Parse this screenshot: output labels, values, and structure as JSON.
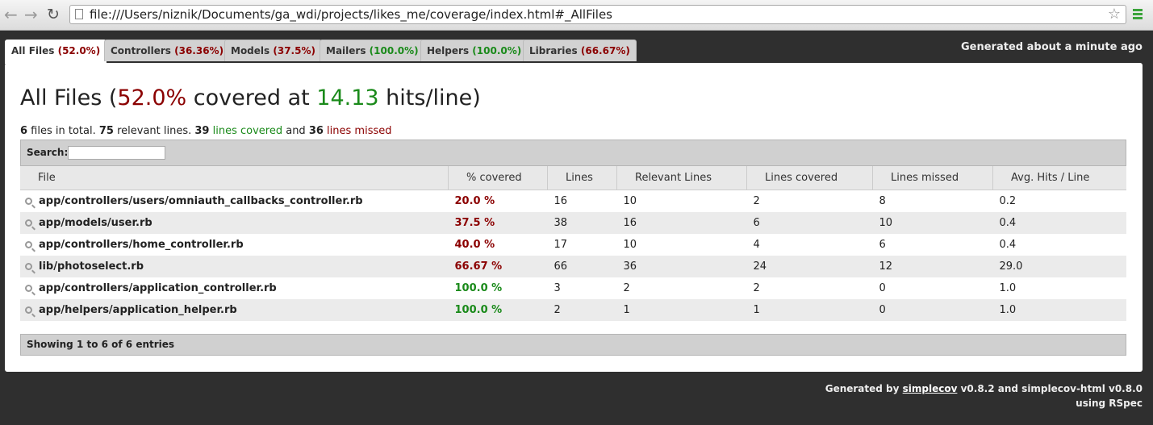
{
  "browser": {
    "url": "file:///Users/niznik/Documents/ga_wdi/projects/likes_me/coverage/index.html#_AllFiles",
    "back": "←",
    "forward": "→",
    "reload": "↻",
    "star": "☆"
  },
  "tabs": [
    {
      "label": "All Files",
      "pct": "(52.0%)",
      "status": "red"
    },
    {
      "label": "Controllers",
      "pct": "(36.36%)",
      "status": "red"
    },
    {
      "label": "Models",
      "pct": "(37.5%)",
      "status": "red"
    },
    {
      "label": "Mailers",
      "pct": "(100.0%)",
      "status": "green"
    },
    {
      "label": "Helpers",
      "pct": "(100.0%)",
      "status": "green"
    },
    {
      "label": "Libraries",
      "pct": "(66.67%)",
      "status": "red"
    }
  ],
  "generated": {
    "label": "Generated",
    "when": "about a minute ago"
  },
  "main": {
    "title_prefix": "All Files (",
    "title_pct": "52.0%",
    "title_mid": " covered at ",
    "title_hits": "14.13",
    "title_suffix": " hits/line)",
    "files_count": "6",
    "files_text": " files in total. ",
    "relevant_count": "75",
    "relevant_text": " relevant lines. ",
    "covered_count": "39",
    "covered_text": " lines covered",
    "and_text": " and ",
    "missed_count": "36",
    "missed_text": " lines missed",
    "search_label": "Search:",
    "showing": "Showing 1 to 6 of 6 entries"
  },
  "table": {
    "headers": [
      "File",
      "% covered",
      "Lines",
      "Relevant Lines",
      "Lines covered",
      "Lines missed",
      "Avg. Hits / Line"
    ],
    "rows": [
      {
        "file": "app/controllers/users/omniauth_callbacks_controller.rb",
        "covered": "20.0 %",
        "status": "red",
        "lines": "16",
        "relevant": "10",
        "lines_covered": "2",
        "missed": "8",
        "avg": "0.2"
      },
      {
        "file": "app/models/user.rb",
        "covered": "37.5 %",
        "status": "red",
        "lines": "38",
        "relevant": "16",
        "lines_covered": "6",
        "missed": "10",
        "avg": "0.4"
      },
      {
        "file": "app/controllers/home_controller.rb",
        "covered": "40.0 %",
        "status": "red",
        "lines": "17",
        "relevant": "10",
        "lines_covered": "4",
        "missed": "6",
        "avg": "0.4"
      },
      {
        "file": "lib/photoselect.rb",
        "covered": "66.67 %",
        "status": "red",
        "lines": "66",
        "relevant": "36",
        "lines_covered": "24",
        "missed": "12",
        "avg": "29.0"
      },
      {
        "file": "app/controllers/application_controller.rb",
        "covered": "100.0 %",
        "status": "green",
        "lines": "3",
        "relevant": "2",
        "lines_covered": "2",
        "missed": "0",
        "avg": "1.0"
      },
      {
        "file": "app/helpers/application_helper.rb",
        "covered": "100.0 %",
        "status": "green",
        "lines": "2",
        "relevant": "1",
        "lines_covered": "1",
        "missed": "0",
        "avg": "1.0"
      }
    ]
  },
  "footer": {
    "generated_by": "Generated by ",
    "link": "simplecov",
    "version_text": " v0.8.2 and simplecov-html v0.8.0",
    "using": "using RSpec"
  },
  "colors": {
    "red": "#8b0000",
    "green": "#1a8a1a",
    "background": "#2f2f2f"
  }
}
